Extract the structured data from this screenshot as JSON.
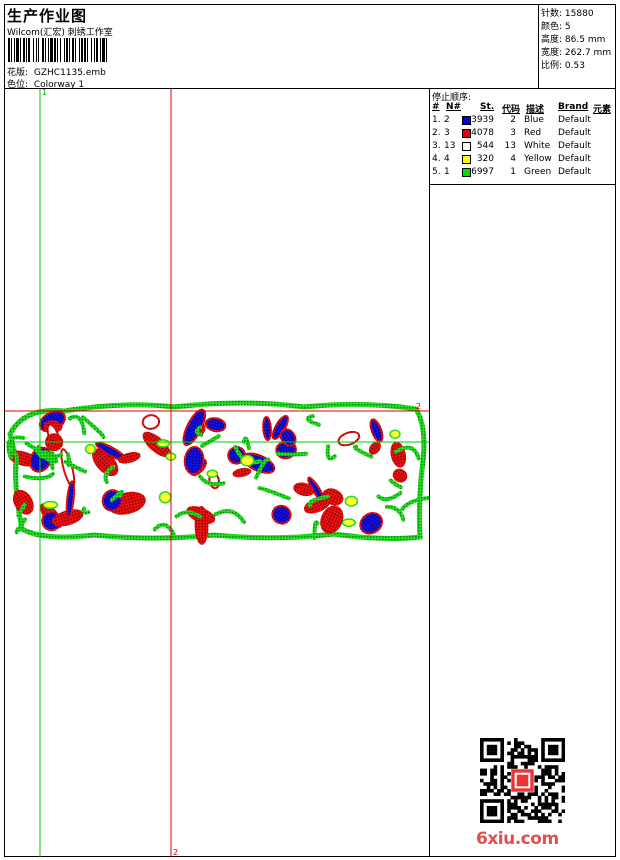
{
  "header": {
    "title": "生产作业图",
    "company": "Wilcom(汇宏) 刺绣工作室",
    "design_label": "花版:",
    "design_value": "GZHC1135.emb",
    "color_label": "色位:",
    "color_value": "Colorway 1"
  },
  "stats": [
    {
      "label": "针数:",
      "value": "15880"
    },
    {
      "label": "颜色:",
      "value": "5"
    },
    {
      "label": "高度:",
      "value": "86.5 mm"
    },
    {
      "label": "宽度:",
      "value": "262.7 mm"
    },
    {
      "label": "比例:",
      "value": "0.53"
    }
  ],
  "legend": {
    "title": "停止顺序:",
    "columns": [
      "#",
      "N#",
      "St.",
      "代码",
      "描述",
      "Brand",
      "元素"
    ],
    "rows": [
      {
        "idx": "1.",
        "n": "2",
        "st": "3939",
        "code": "2",
        "desc": "Blue",
        "brand": "Default",
        "color": "#0000e0"
      },
      {
        "idx": "2.",
        "n": "3",
        "st": "4078",
        "code": "3",
        "desc": "Red",
        "brand": "Default",
        "color": "#e00000"
      },
      {
        "idx": "3.",
        "n": "13",
        "st": "544",
        "code": "13",
        "desc": "White",
        "brand": "Default",
        "color": "#ffffff"
      },
      {
        "idx": "4.",
        "n": "4",
        "st": "320",
        "code": "4",
        "desc": "Yellow",
        "brand": "Default",
        "color": "#ffff00"
      },
      {
        "idx": "5.",
        "n": "1",
        "st": "6997",
        "code": "1",
        "desc": "Green",
        "brand": "Default",
        "color": "#00e000"
      }
    ]
  },
  "guides": {
    "green_label": "1",
    "red_h_label": "2",
    "red_v_label": "2",
    "green_color": "#00cc00",
    "red_color": "#dd0000"
  },
  "watermark": "6xiu.com"
}
